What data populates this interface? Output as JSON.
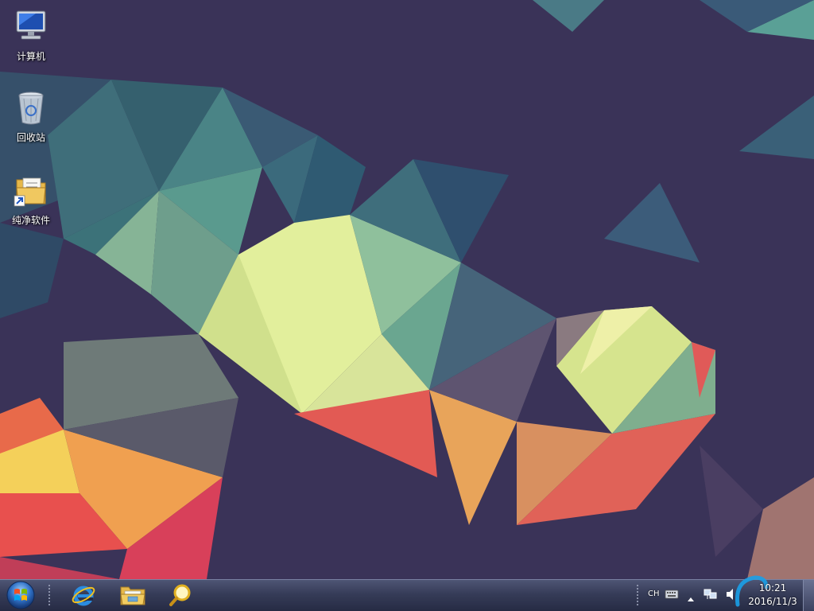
{
  "desktop": {
    "icons": [
      {
        "label": "计算机",
        "icon": "computer-icon"
      },
      {
        "label": "回收站",
        "icon": "recycle-bin-icon"
      },
      {
        "label": "纯净软件",
        "icon": "folder-shortcut-icon"
      }
    ]
  },
  "taskbar": {
    "start": {
      "icon": "windows-orb-icon"
    },
    "pinned": [
      {
        "icon": "internet-explorer-icon"
      },
      {
        "icon": "file-explorer-icon"
      },
      {
        "icon": "search-icon"
      }
    ],
    "tray": {
      "language": "CH",
      "icons": [
        "keyboard-icon",
        "show-hidden-icons-icon",
        "network-icon",
        "volume-icon"
      ],
      "time": "10:21",
      "date": "2016/11/3"
    }
  },
  "colors": {
    "wallpaper_base": "#3a3358",
    "taskbar_top": "#4e5574",
    "taskbar_bottom": "#262b44"
  }
}
